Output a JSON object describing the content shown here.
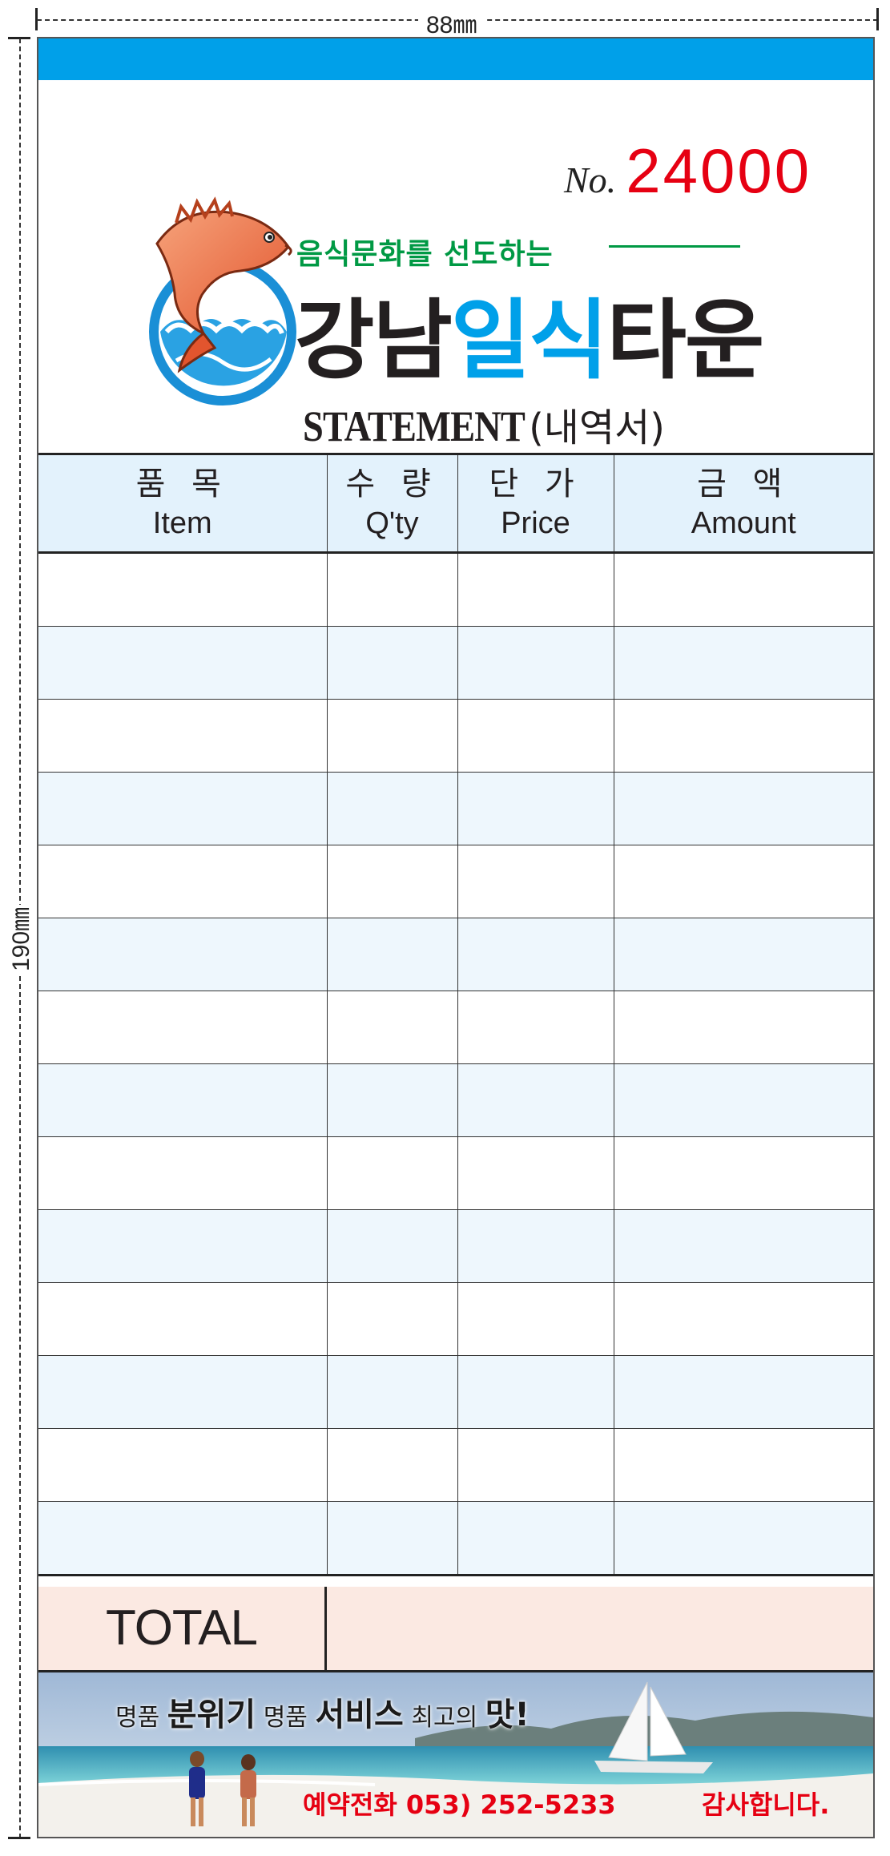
{
  "dimensions": {
    "width_label": "88㎜",
    "height_label": "190㎜"
  },
  "colors": {
    "accent_blue": "#00a0e9",
    "serial_red": "#e60012",
    "slogan_green": "#009944",
    "header_fill": "#e3f2fc",
    "stripe_fill": "#eef7fd",
    "total_fill": "#fbe9e2",
    "phone_red": "#e60012"
  },
  "serial": {
    "label": "No.",
    "number": "24000"
  },
  "logo": {
    "icon": "fish-wave-icon"
  },
  "slogan": "음식문화를 선도하는",
  "brand": {
    "part1": "강남",
    "highlight": "일식",
    "part2": "타운"
  },
  "statement": {
    "en": "STATEMENT",
    "ko": "(내역서)"
  },
  "table": {
    "columns": [
      {
        "ko": "품 목",
        "en": "Item"
      },
      {
        "ko": "수 량",
        "en": "Q'ty"
      },
      {
        "ko": "단 가",
        "en": "Price"
      },
      {
        "ko": "금 액",
        "en": "Amount"
      }
    ],
    "row_count": 14
  },
  "total_label": "TOTAL",
  "banner": {
    "slogan_parts": [
      {
        "text": "명품 ",
        "style": "s"
      },
      {
        "text": "분위기",
        "style": "b"
      },
      {
        "text": " 명품 ",
        "style": "s"
      },
      {
        "text": "서비스",
        "style": "b"
      },
      {
        "text": " 최고의 ",
        "style": "s"
      },
      {
        "text": "맛!",
        "style": "b"
      }
    ],
    "phone_label": "예약전화",
    "phone_number": "053) 252-5233",
    "thanks": "감사합니다."
  }
}
